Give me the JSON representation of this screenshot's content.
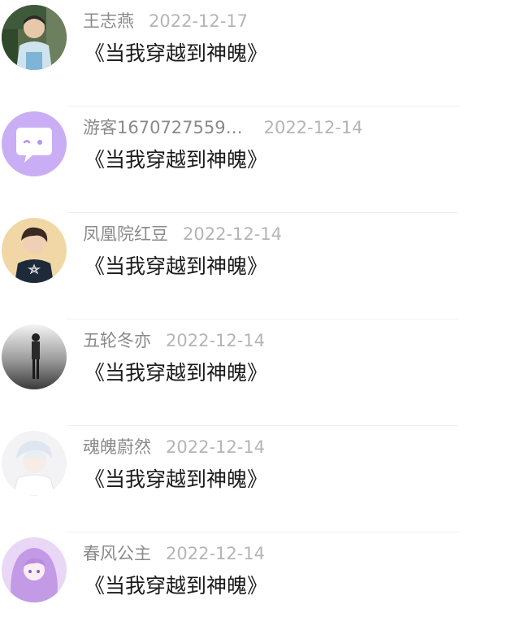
{
  "comments": [
    {
      "user": "王志燕",
      "date": "2022-12-17",
      "text": "《当我穿越到神魄》",
      "avatar_icon": "boy-photo-avatar"
    },
    {
      "user": "游客1670727559…",
      "date": "2022-12-14",
      "text": "《当我穿越到神魄》",
      "avatar_icon": "purple-chat-bubble-avatar"
    },
    {
      "user": "凤凰院红豆",
      "date": "2022-12-14",
      "text": "《当我穿越到神魄》",
      "avatar_icon": "boy-star-shirt-avatar"
    },
    {
      "user": "五轮冬亦",
      "date": "2022-12-14",
      "text": "《当我穿越到神魄》",
      "avatar_icon": "man-silhouette-avatar"
    },
    {
      "user": "魂魄蔚然",
      "date": "2022-12-14",
      "text": "《当我穿越到神魄》",
      "avatar_icon": "anime-boy-avatar"
    },
    {
      "user": "春风公主",
      "date": "2022-12-14",
      "text": "《当我穿越到神魄》",
      "avatar_icon": "anime-girl-purple-avatar"
    }
  ],
  "colors": {
    "username": "#8a8a8a",
    "date": "#b5b5b5",
    "text": "#1a1a1a",
    "default_avatar": "#c9aef5"
  }
}
